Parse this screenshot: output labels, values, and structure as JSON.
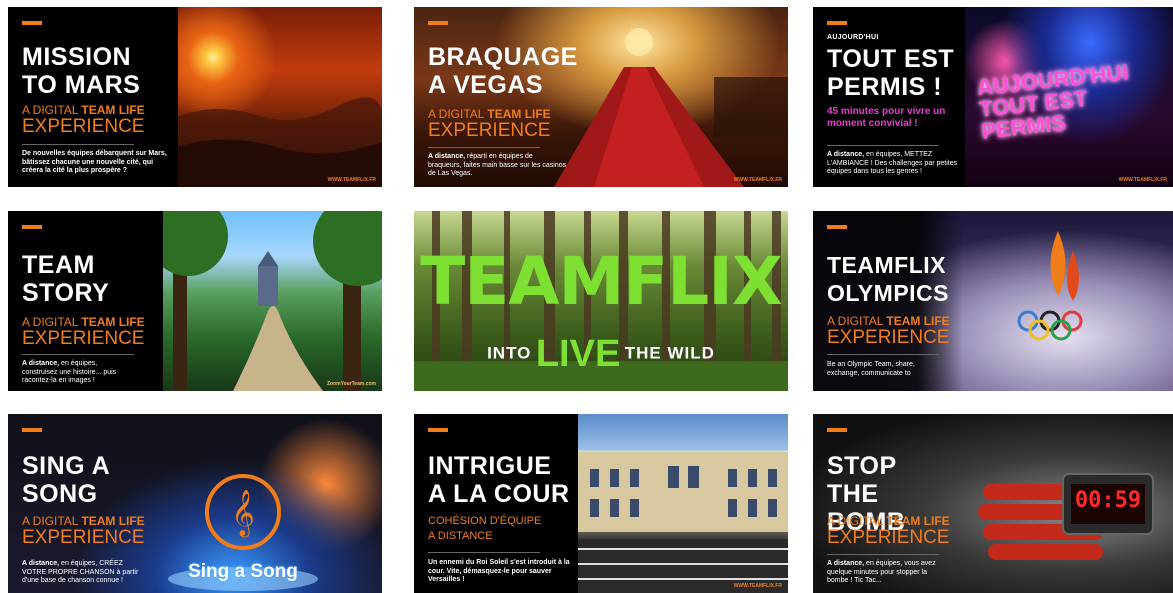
{
  "colors": {
    "accent": "#f07d1a",
    "pink": "#e83bd2",
    "green": "#7ee033"
  },
  "cards": {
    "mars": {
      "title_1": "MISSION",
      "title_2": "TO MARS",
      "line1": "A DIGITAL",
      "line1_bold": "TEAM LIFE",
      "line2": "EXPERIENCE",
      "desc": "De nouvelles équipes débarquent sur Mars, bâtissez chacune une nouvelle cité, qui créera la cité la plus prospère ?",
      "site": "WWW.TEAMFLIX.FR"
    },
    "vegas": {
      "title_1": "BRAQUAGE",
      "title_2": "A VEGAS",
      "line1": "A DIGITAL",
      "line1_bold": "TEAM LIFE",
      "line2": "EXPERIENCE",
      "desc_bold": "A distance,",
      "desc": "réparti en équipes de braqueurs, faites main basse sur les casinos de Las Vegas.",
      "site": "WWW.TEAMFLIX.FR"
    },
    "permis": {
      "kicker": "AUJOURD'HUI",
      "title_1": "TOUT EST",
      "title_2": "PERMIS !",
      "pink": "45 minutes pour vivre un moment convivial !",
      "desc_bold": "A distance,",
      "desc": "en équipes, METTEZ L'AMBIANCE ! Des challenges par petites équipes dans tous les genres !",
      "neon_1": "AUJOURD'HUI",
      "neon_2": "TOUT EST",
      "neon_3": "PERMIS",
      "site": "WWW.TEAMFLIX.FR"
    },
    "story": {
      "title_1": "TEAM",
      "title_2": "STORY",
      "line1": "A DIGITAL",
      "line1_bold": "TEAM LIFE",
      "line2": "EXPERIENCE",
      "desc_bold": "A distance,",
      "desc": "en équipes, construisez une histoire... puis racontez-la en images !",
      "site": "ZoomYourTeam.com"
    },
    "wild": {
      "big": "TEAMFLIX",
      "into": "INTO",
      "live": "LIVE",
      "the_wild": "THE WILD"
    },
    "olympics": {
      "title_1": "TEAMFLIX",
      "title_2": "OLYMPICS",
      "line1": "A DIGITAL",
      "line1_bold": "TEAM LIFE",
      "line2": "EXPERIENCE",
      "desc": "Be an Olympic Team, share, exchange, communicate to"
    },
    "song": {
      "title_1": "SING A",
      "title_2": "SONG",
      "line1": "A DIGITAL",
      "line1_bold": "TEAM LIFE",
      "line2": "EXPERIENCE",
      "desc_bold": "A distance,",
      "desc": "en équipes, CRÉEZ VOTRE PROPRE CHANSON à partir d'une base de chanson connue !",
      "logo": "Sing a Song"
    },
    "cour": {
      "title_1": "INTRIGUE",
      "title_2": "A LA COUR",
      "line1": "COHÉSION D'ÉQUIPE",
      "line2": "A DISTANCE",
      "desc": "Un ennemi du Roi Soleil s'est introduit à la cour. Vite, démasquez-le pour sauver Versailles !",
      "site": "WWW.TEAMFLIX.FR"
    },
    "bomb": {
      "title_1": "STOP THE",
      "title_2": "BOMB",
      "line1": "A DIGITAL",
      "line1_bold": "TEAM LIFE",
      "line2": "EXPERIENCE",
      "desc_bold": "A distance,",
      "desc": "en équipes, vous avez quelque minutes pour stopper la bombe ! Tic Tac...",
      "timer": "00:59"
    }
  }
}
